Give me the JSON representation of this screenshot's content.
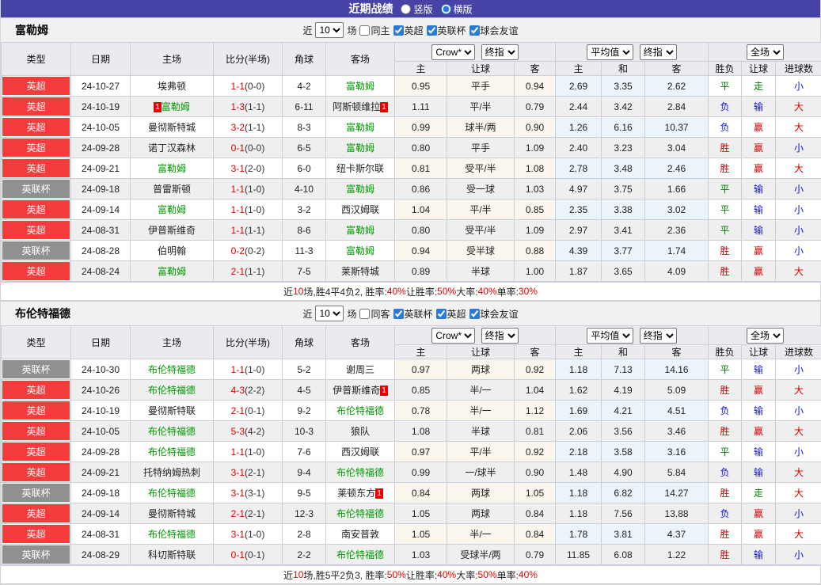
{
  "titlebar": {
    "title": "近期战绩",
    "radios": [
      {
        "label": "竖版",
        "selected": false
      },
      {
        "label": "横版",
        "selected": true
      }
    ]
  },
  "filter_text": {
    "near": "近",
    "count": "10",
    "games": "场"
  },
  "table_header": {
    "type": "类型",
    "date": "日期",
    "home": "主场",
    "score": "比分(半场)",
    "corner": "角球",
    "away": "客场",
    "crow_select": "Crow*",
    "final_select": "终指",
    "avg_select": "平均值",
    "final_select2": "终指",
    "scope_select": "全场",
    "sub_home": "主",
    "sub_handicap": "让球",
    "sub_away": "客",
    "sub_avg_home": "主",
    "sub_avg_draw": "和",
    "sub_avg_away": "客",
    "sub_outcome": "胜负",
    "sub_let": "让球",
    "sub_goals": "进球数"
  },
  "colors": {
    "accent_purple": "#4743a6",
    "league_epl": "#f43c3c",
    "league_cup": "#909090",
    "team_green": "#009900",
    "score_red": "#e60000",
    "win_red": "#d70000",
    "draw_green": "#008000",
    "loss_blue": "#1414cc",
    "odds_bg": "#fbf6ed",
    "avg_bg": "#eaf4fa"
  },
  "sections": [
    {
      "team": "富勒姆",
      "same_label": "同主",
      "same_checked": false,
      "leagues": [
        {
          "label": "英超",
          "checked": true
        },
        {
          "label": "英联杯",
          "checked": true
        },
        {
          "label": "球会友谊",
          "checked": true
        }
      ],
      "rows": [
        {
          "league": "英超",
          "cup": false,
          "date": "24-10-27",
          "home": "埃弗顿",
          "home_focal": false,
          "home_card": false,
          "score": "1-1",
          "half": "(0-0)",
          "corner": "4-2",
          "away": "富勒姆",
          "away_focal": true,
          "away_card": false,
          "odds": [
            "0.95",
            "平手",
            "0.94"
          ],
          "avg": [
            "2.69",
            "3.35",
            "2.62"
          ],
          "results": [
            [
              "平",
              "g"
            ],
            [
              "走",
              "g"
            ],
            [
              "小",
              "b"
            ]
          ]
        },
        {
          "league": "英超",
          "cup": false,
          "date": "24-10-19",
          "home": "富勒姆",
          "home_focal": true,
          "home_card": true,
          "score": "1-3",
          "half": "(1-1)",
          "corner": "6-11",
          "away": "阿斯顿维拉",
          "away_focal": false,
          "away_card": true,
          "odds": [
            "1.11",
            "平/半",
            "0.79"
          ],
          "avg": [
            "2.44",
            "3.42",
            "2.84"
          ],
          "results": [
            [
              "负",
              "b"
            ],
            [
              "输",
              "b"
            ],
            [
              "大",
              "r"
            ]
          ]
        },
        {
          "league": "英超",
          "cup": false,
          "date": "24-10-05",
          "home": "曼彻斯特城",
          "home_focal": false,
          "home_card": false,
          "score": "3-2",
          "half": "(1-1)",
          "corner": "8-3",
          "away": "富勒姆",
          "away_focal": true,
          "away_card": false,
          "odds": [
            "0.99",
            "球半/两",
            "0.90"
          ],
          "avg": [
            "1.26",
            "6.16",
            "10.37"
          ],
          "results": [
            [
              "负",
              "b"
            ],
            [
              "赢",
              "r"
            ],
            [
              "大",
              "r"
            ]
          ]
        },
        {
          "league": "英超",
          "cup": false,
          "date": "24-09-28",
          "home": "诺丁汉森林",
          "home_focal": false,
          "home_card": false,
          "score": "0-1",
          "half": "(0-0)",
          "corner": "6-5",
          "away": "富勒姆",
          "away_focal": true,
          "away_card": false,
          "odds": [
            "0.80",
            "平手",
            "1.09"
          ],
          "avg": [
            "2.40",
            "3.23",
            "3.04"
          ],
          "results": [
            [
              "胜",
              "r"
            ],
            [
              "赢",
              "r"
            ],
            [
              "小",
              "b"
            ]
          ]
        },
        {
          "league": "英超",
          "cup": false,
          "date": "24-09-21",
          "home": "富勒姆",
          "home_focal": true,
          "home_card": false,
          "score": "3-1",
          "half": "(2-0)",
          "corner": "6-0",
          "away": "纽卡斯尔联",
          "away_focal": false,
          "away_card": false,
          "odds": [
            "0.81",
            "受平/半",
            "1.08"
          ],
          "avg": [
            "2.78",
            "3.48",
            "2.46"
          ],
          "results": [
            [
              "胜",
              "r"
            ],
            [
              "赢",
              "r"
            ],
            [
              "大",
              "r"
            ]
          ]
        },
        {
          "league": "英联杯",
          "cup": true,
          "date": "24-09-18",
          "home": "普雷斯顿",
          "home_focal": false,
          "home_card": false,
          "score": "1-1",
          "half": "(1-0)",
          "corner": "4-10",
          "away": "富勒姆",
          "away_focal": true,
          "away_card": false,
          "odds": [
            "0.86",
            "受一球",
            "1.03"
          ],
          "avg": [
            "4.97",
            "3.75",
            "1.66"
          ],
          "results": [
            [
              "平",
              "g"
            ],
            [
              "输",
              "b"
            ],
            [
              "小",
              "b"
            ]
          ]
        },
        {
          "league": "英超",
          "cup": false,
          "date": "24-09-14",
          "home": "富勒姆",
          "home_focal": true,
          "home_card": false,
          "score": "1-1",
          "half": "(1-0)",
          "corner": "3-2",
          "away": "西汉姆联",
          "away_focal": false,
          "away_card": false,
          "odds": [
            "1.04",
            "平/半",
            "0.85"
          ],
          "avg": [
            "2.35",
            "3.38",
            "3.02"
          ],
          "results": [
            [
              "平",
              "g"
            ],
            [
              "输",
              "b"
            ],
            [
              "小",
              "b"
            ]
          ]
        },
        {
          "league": "英超",
          "cup": false,
          "date": "24-08-31",
          "home": "伊普斯维奇",
          "home_focal": false,
          "home_card": false,
          "score": "1-1",
          "half": "(1-1)",
          "corner": "8-6",
          "away": "富勒姆",
          "away_focal": true,
          "away_card": false,
          "odds": [
            "0.80",
            "受平/半",
            "1.09"
          ],
          "avg": [
            "2.97",
            "3.41",
            "2.36"
          ],
          "results": [
            [
              "平",
              "g"
            ],
            [
              "输",
              "b"
            ],
            [
              "小",
              "b"
            ]
          ]
        },
        {
          "league": "英联杯",
          "cup": true,
          "date": "24-08-28",
          "home": "伯明翰",
          "home_focal": false,
          "home_card": false,
          "score": "0-2",
          "half": "(0-2)",
          "corner": "11-3",
          "away": "富勒姆",
          "away_focal": true,
          "away_card": false,
          "odds": [
            "0.94",
            "受半球",
            "0.88"
          ],
          "avg": [
            "4.39",
            "3.77",
            "1.74"
          ],
          "results": [
            [
              "胜",
              "r"
            ],
            [
              "赢",
              "r"
            ],
            [
              "小",
              "b"
            ]
          ]
        },
        {
          "league": "英超",
          "cup": false,
          "date": "24-08-24",
          "home": "富勒姆",
          "home_focal": true,
          "home_card": false,
          "score": "2-1",
          "half": "(1-1)",
          "corner": "7-5",
          "away": "莱斯特城",
          "away_focal": false,
          "away_card": false,
          "odds": [
            "0.89",
            "半球",
            "1.00"
          ],
          "avg": [
            "1.87",
            "3.65",
            "4.09"
          ],
          "results": [
            [
              "胜",
              "r"
            ],
            [
              "赢",
              "r"
            ],
            [
              "大",
              "r"
            ]
          ]
        }
      ],
      "summary": [
        [
          "近",
          "k"
        ],
        [
          "10",
          "r"
        ],
        [
          "场,胜4平4负2, 胜率:",
          "k"
        ],
        [
          "40%",
          "r"
        ],
        [
          " 让胜率:",
          "k"
        ],
        [
          "50%",
          "r"
        ],
        [
          " 大率:",
          "k"
        ],
        [
          "40%",
          "r"
        ],
        [
          " 单率:",
          "k"
        ],
        [
          "30%",
          "r"
        ]
      ]
    },
    {
      "team": "布伦特福德",
      "same_label": "同客",
      "same_checked": false,
      "leagues": [
        {
          "label": "英联杯",
          "checked": true
        },
        {
          "label": "英超",
          "checked": true
        },
        {
          "label": "球会友谊",
          "checked": true
        }
      ],
      "rows": [
        {
          "league": "英联杯",
          "cup": true,
          "date": "24-10-30",
          "home": "布伦特福德",
          "home_focal": true,
          "home_card": false,
          "score": "1-1",
          "half": "(1-0)",
          "corner": "5-2",
          "away": "谢周三",
          "away_focal": false,
          "away_card": false,
          "odds": [
            "0.97",
            "两球",
            "0.92"
          ],
          "avg": [
            "1.18",
            "7.13",
            "14.16"
          ],
          "results": [
            [
              "平",
              "g"
            ],
            [
              "输",
              "b"
            ],
            [
              "小",
              "b"
            ]
          ]
        },
        {
          "league": "英超",
          "cup": false,
          "date": "24-10-26",
          "home": "布伦特福德",
          "home_focal": true,
          "home_card": false,
          "score": "4-3",
          "half": "(2-2)",
          "corner": "4-5",
          "away": "伊普斯维奇",
          "away_focal": false,
          "away_card": true,
          "odds": [
            "0.85",
            "半/一",
            "1.04"
          ],
          "avg": [
            "1.62",
            "4.19",
            "5.09"
          ],
          "results": [
            [
              "胜",
              "r"
            ],
            [
              "赢",
              "r"
            ],
            [
              "大",
              "r"
            ]
          ]
        },
        {
          "league": "英超",
          "cup": false,
          "date": "24-10-19",
          "home": "曼彻斯特联",
          "home_focal": false,
          "home_card": false,
          "score": "2-1",
          "half": "(0-1)",
          "corner": "9-2",
          "away": "布伦特福德",
          "away_focal": true,
          "away_card": false,
          "odds": [
            "0.78",
            "半/一",
            "1.12"
          ],
          "avg": [
            "1.69",
            "4.21",
            "4.51"
          ],
          "results": [
            [
              "负",
              "b"
            ],
            [
              "输",
              "b"
            ],
            [
              "小",
              "b"
            ]
          ]
        },
        {
          "league": "英超",
          "cup": false,
          "date": "24-10-05",
          "home": "布伦特福德",
          "home_focal": true,
          "home_card": false,
          "score": "5-3",
          "half": "(4-2)",
          "corner": "10-3",
          "away": "狼队",
          "away_focal": false,
          "away_card": false,
          "odds": [
            "1.08",
            "半球",
            "0.81"
          ],
          "avg": [
            "2.06",
            "3.56",
            "3.46"
          ],
          "results": [
            [
              "胜",
              "r"
            ],
            [
              "赢",
              "r"
            ],
            [
              "大",
              "r"
            ]
          ]
        },
        {
          "league": "英超",
          "cup": false,
          "date": "24-09-28",
          "home": "布伦特福德",
          "home_focal": true,
          "home_card": false,
          "score": "1-1",
          "half": "(1-0)",
          "corner": "7-6",
          "away": "西汉姆联",
          "away_focal": false,
          "away_card": false,
          "odds": [
            "0.97",
            "平/半",
            "0.92"
          ],
          "avg": [
            "2.18",
            "3.58",
            "3.16"
          ],
          "results": [
            [
              "平",
              "g"
            ],
            [
              "输",
              "b"
            ],
            [
              "小",
              "b"
            ]
          ]
        },
        {
          "league": "英超",
          "cup": false,
          "date": "24-09-21",
          "home": "托特纳姆热刺",
          "home_focal": false,
          "home_card": false,
          "score": "3-1",
          "half": "(2-1)",
          "corner": "9-4",
          "away": "布伦特福德",
          "away_focal": true,
          "away_card": false,
          "odds": [
            "0.99",
            "一/球半",
            "0.90"
          ],
          "avg": [
            "1.48",
            "4.90",
            "5.84"
          ],
          "results": [
            [
              "负",
              "b"
            ],
            [
              "输",
              "b"
            ],
            [
              "大",
              "r"
            ]
          ]
        },
        {
          "league": "英联杯",
          "cup": true,
          "date": "24-09-18",
          "home": "布伦特福德",
          "home_focal": true,
          "home_card": false,
          "score": "3-1",
          "half": "(3-1)",
          "corner": "9-5",
          "away": "莱顿东方",
          "away_focal": false,
          "away_card": true,
          "odds": [
            "0.84",
            "两球",
            "1.05"
          ],
          "avg": [
            "1.18",
            "6.82",
            "14.27"
          ],
          "results": [
            [
              "胜",
              "r"
            ],
            [
              "走",
              "g"
            ],
            [
              "大",
              "r"
            ]
          ]
        },
        {
          "league": "英超",
          "cup": false,
          "date": "24-09-14",
          "home": "曼彻斯特城",
          "home_focal": false,
          "home_card": false,
          "score": "2-1",
          "half": "(2-1)",
          "corner": "12-3",
          "away": "布伦特福德",
          "away_focal": true,
          "away_card": false,
          "odds": [
            "1.05",
            "两球",
            "0.84"
          ],
          "avg": [
            "1.18",
            "7.56",
            "13.88"
          ],
          "results": [
            [
              "负",
              "b"
            ],
            [
              "赢",
              "r"
            ],
            [
              "小",
              "b"
            ]
          ]
        },
        {
          "league": "英超",
          "cup": false,
          "date": "24-08-31",
          "home": "布伦特福德",
          "home_focal": true,
          "home_card": false,
          "score": "3-1",
          "half": "(1-0)",
          "corner": "2-8",
          "away": "南安普敦",
          "away_focal": false,
          "away_card": false,
          "odds": [
            "1.05",
            "半/一",
            "0.84"
          ],
          "avg": [
            "1.78",
            "3.81",
            "4.37"
          ],
          "results": [
            [
              "胜",
              "r"
            ],
            [
              "赢",
              "r"
            ],
            [
              "大",
              "r"
            ]
          ]
        },
        {
          "league": "英联杯",
          "cup": true,
          "date": "24-08-29",
          "home": "科切斯特联",
          "home_focal": false,
          "home_card": false,
          "score": "0-1",
          "half": "(0-1)",
          "corner": "2-2",
          "away": "布伦特福德",
          "away_focal": true,
          "away_card": false,
          "odds": [
            "1.03",
            "受球半/两",
            "0.79"
          ],
          "avg": [
            "11.85",
            "6.08",
            "1.22"
          ],
          "results": [
            [
              "胜",
              "r"
            ],
            [
              "输",
              "b"
            ],
            [
              "小",
              "b"
            ]
          ]
        }
      ],
      "summary": [
        [
          "近",
          "k"
        ],
        [
          "10",
          "r"
        ],
        [
          "场,胜5平2负3, 胜率:",
          "k"
        ],
        [
          "50%",
          "r"
        ],
        [
          " 让胜率:",
          "k"
        ],
        [
          "40%",
          "r"
        ],
        [
          " 大率:",
          "k"
        ],
        [
          "50%",
          "r"
        ],
        [
          " 单率:",
          "k"
        ],
        [
          "40%",
          "r"
        ]
      ]
    }
  ]
}
